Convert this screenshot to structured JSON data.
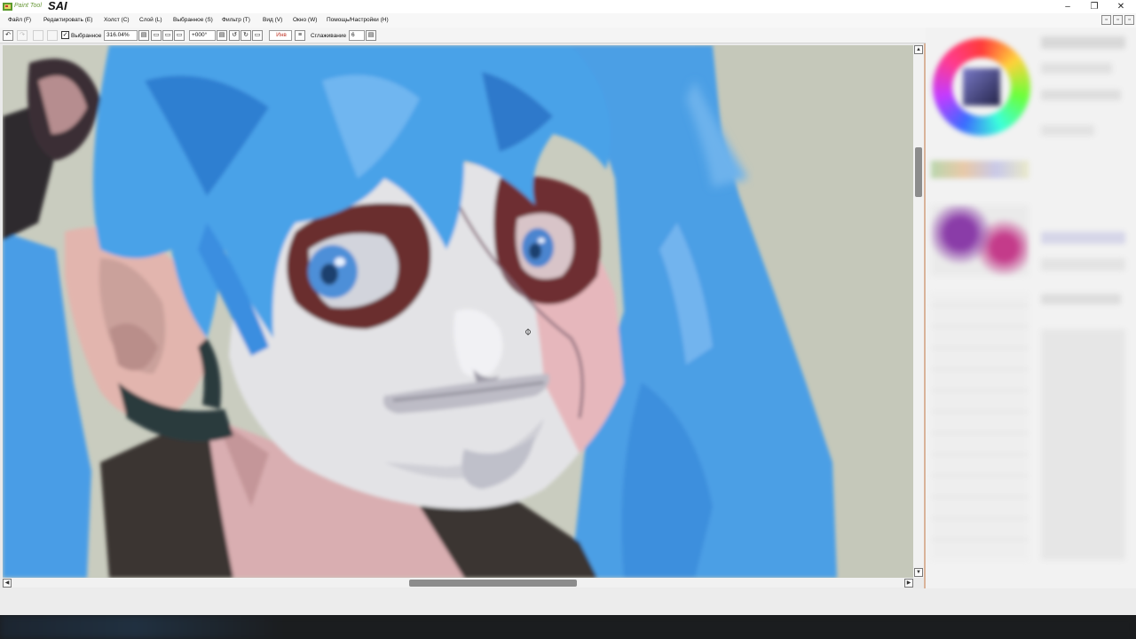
{
  "app": {
    "brand": "Paint Tool",
    "title": "SAI"
  },
  "window_controls": {
    "minimize": "–",
    "maximize": "❐",
    "close": "✕"
  },
  "menu": [
    "Файл (F)",
    "Редактировать (E)",
    "Холст (C)",
    "Слой (L)",
    "Выбранное (S)",
    "Фильтр (T)",
    "Вид (V)",
    "Окно (W)",
    "Помощь/Настройки (H)"
  ],
  "toolbar": {
    "selection_label": "Выбранное",
    "selection_checked": true,
    "zoom_value": "316.04%",
    "rotation_value": "+000°",
    "invert_label": "Инв",
    "smoothing_label": "Сглаживание",
    "smoothing_value": "6"
  },
  "scrollbars": {
    "up_arrow": "▲",
    "down_arrow": "▼",
    "left_arrow": "◀",
    "right_arrow": "▶"
  },
  "colors": {
    "canvas_background": "#c9ccbf",
    "hair_blue": "#4a9fe6",
    "skin_light": "#e3e3e6",
    "skin_pink": "#e6b7bc",
    "eye_socket": "#6b2e2e",
    "jacket_dark": "#3a3330",
    "panel_border": "#d9b39a",
    "taskbar": "#1b1d1f"
  },
  "icons": {
    "app_logo": "paint-tool-sai-icon",
    "cursor": "brush-cursor-icon"
  }
}
